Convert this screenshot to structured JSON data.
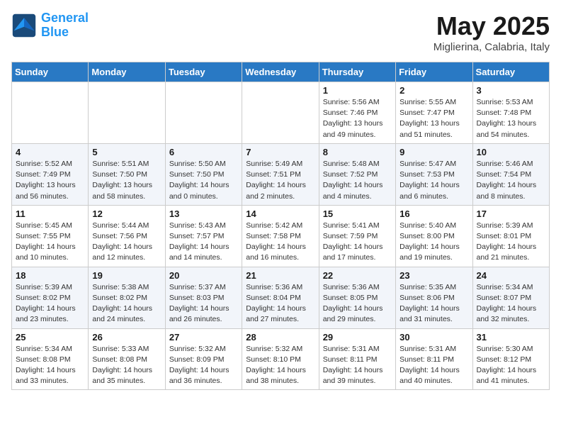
{
  "header": {
    "logo_line1": "General",
    "logo_line2": "Blue",
    "month_title": "May 2025",
    "location": "Miglierina, Calabria, Italy"
  },
  "weekdays": [
    "Sunday",
    "Monday",
    "Tuesday",
    "Wednesday",
    "Thursday",
    "Friday",
    "Saturday"
  ],
  "rows": [
    [
      {
        "day": "",
        "info": ""
      },
      {
        "day": "",
        "info": ""
      },
      {
        "day": "",
        "info": ""
      },
      {
        "day": "",
        "info": ""
      },
      {
        "day": "1",
        "info": "Sunrise: 5:56 AM\nSunset: 7:46 PM\nDaylight: 13 hours\nand 49 minutes."
      },
      {
        "day": "2",
        "info": "Sunrise: 5:55 AM\nSunset: 7:47 PM\nDaylight: 13 hours\nand 51 minutes."
      },
      {
        "day": "3",
        "info": "Sunrise: 5:53 AM\nSunset: 7:48 PM\nDaylight: 13 hours\nand 54 minutes."
      }
    ],
    [
      {
        "day": "4",
        "info": "Sunrise: 5:52 AM\nSunset: 7:49 PM\nDaylight: 13 hours\nand 56 minutes."
      },
      {
        "day": "5",
        "info": "Sunrise: 5:51 AM\nSunset: 7:50 PM\nDaylight: 13 hours\nand 58 minutes."
      },
      {
        "day": "6",
        "info": "Sunrise: 5:50 AM\nSunset: 7:50 PM\nDaylight: 14 hours\nand 0 minutes."
      },
      {
        "day": "7",
        "info": "Sunrise: 5:49 AM\nSunset: 7:51 PM\nDaylight: 14 hours\nand 2 minutes."
      },
      {
        "day": "8",
        "info": "Sunrise: 5:48 AM\nSunset: 7:52 PM\nDaylight: 14 hours\nand 4 minutes."
      },
      {
        "day": "9",
        "info": "Sunrise: 5:47 AM\nSunset: 7:53 PM\nDaylight: 14 hours\nand 6 minutes."
      },
      {
        "day": "10",
        "info": "Sunrise: 5:46 AM\nSunset: 7:54 PM\nDaylight: 14 hours\nand 8 minutes."
      }
    ],
    [
      {
        "day": "11",
        "info": "Sunrise: 5:45 AM\nSunset: 7:55 PM\nDaylight: 14 hours\nand 10 minutes."
      },
      {
        "day": "12",
        "info": "Sunrise: 5:44 AM\nSunset: 7:56 PM\nDaylight: 14 hours\nand 12 minutes."
      },
      {
        "day": "13",
        "info": "Sunrise: 5:43 AM\nSunset: 7:57 PM\nDaylight: 14 hours\nand 14 minutes."
      },
      {
        "day": "14",
        "info": "Sunrise: 5:42 AM\nSunset: 7:58 PM\nDaylight: 14 hours\nand 16 minutes."
      },
      {
        "day": "15",
        "info": "Sunrise: 5:41 AM\nSunset: 7:59 PM\nDaylight: 14 hours\nand 17 minutes."
      },
      {
        "day": "16",
        "info": "Sunrise: 5:40 AM\nSunset: 8:00 PM\nDaylight: 14 hours\nand 19 minutes."
      },
      {
        "day": "17",
        "info": "Sunrise: 5:39 AM\nSunset: 8:01 PM\nDaylight: 14 hours\nand 21 minutes."
      }
    ],
    [
      {
        "day": "18",
        "info": "Sunrise: 5:39 AM\nSunset: 8:02 PM\nDaylight: 14 hours\nand 23 minutes."
      },
      {
        "day": "19",
        "info": "Sunrise: 5:38 AM\nSunset: 8:02 PM\nDaylight: 14 hours\nand 24 minutes."
      },
      {
        "day": "20",
        "info": "Sunrise: 5:37 AM\nSunset: 8:03 PM\nDaylight: 14 hours\nand 26 minutes."
      },
      {
        "day": "21",
        "info": "Sunrise: 5:36 AM\nSunset: 8:04 PM\nDaylight: 14 hours\nand 27 minutes."
      },
      {
        "day": "22",
        "info": "Sunrise: 5:36 AM\nSunset: 8:05 PM\nDaylight: 14 hours\nand 29 minutes."
      },
      {
        "day": "23",
        "info": "Sunrise: 5:35 AM\nSunset: 8:06 PM\nDaylight: 14 hours\nand 31 minutes."
      },
      {
        "day": "24",
        "info": "Sunrise: 5:34 AM\nSunset: 8:07 PM\nDaylight: 14 hours\nand 32 minutes."
      }
    ],
    [
      {
        "day": "25",
        "info": "Sunrise: 5:34 AM\nSunset: 8:08 PM\nDaylight: 14 hours\nand 33 minutes."
      },
      {
        "day": "26",
        "info": "Sunrise: 5:33 AM\nSunset: 8:08 PM\nDaylight: 14 hours\nand 35 minutes."
      },
      {
        "day": "27",
        "info": "Sunrise: 5:32 AM\nSunset: 8:09 PM\nDaylight: 14 hours\nand 36 minutes."
      },
      {
        "day": "28",
        "info": "Sunrise: 5:32 AM\nSunset: 8:10 PM\nDaylight: 14 hours\nand 38 minutes."
      },
      {
        "day": "29",
        "info": "Sunrise: 5:31 AM\nSunset: 8:11 PM\nDaylight: 14 hours\nand 39 minutes."
      },
      {
        "day": "30",
        "info": "Sunrise: 5:31 AM\nSunset: 8:11 PM\nDaylight: 14 hours\nand 40 minutes."
      },
      {
        "day": "31",
        "info": "Sunrise: 5:30 AM\nSunset: 8:12 PM\nDaylight: 14 hours\nand 41 minutes."
      }
    ]
  ]
}
